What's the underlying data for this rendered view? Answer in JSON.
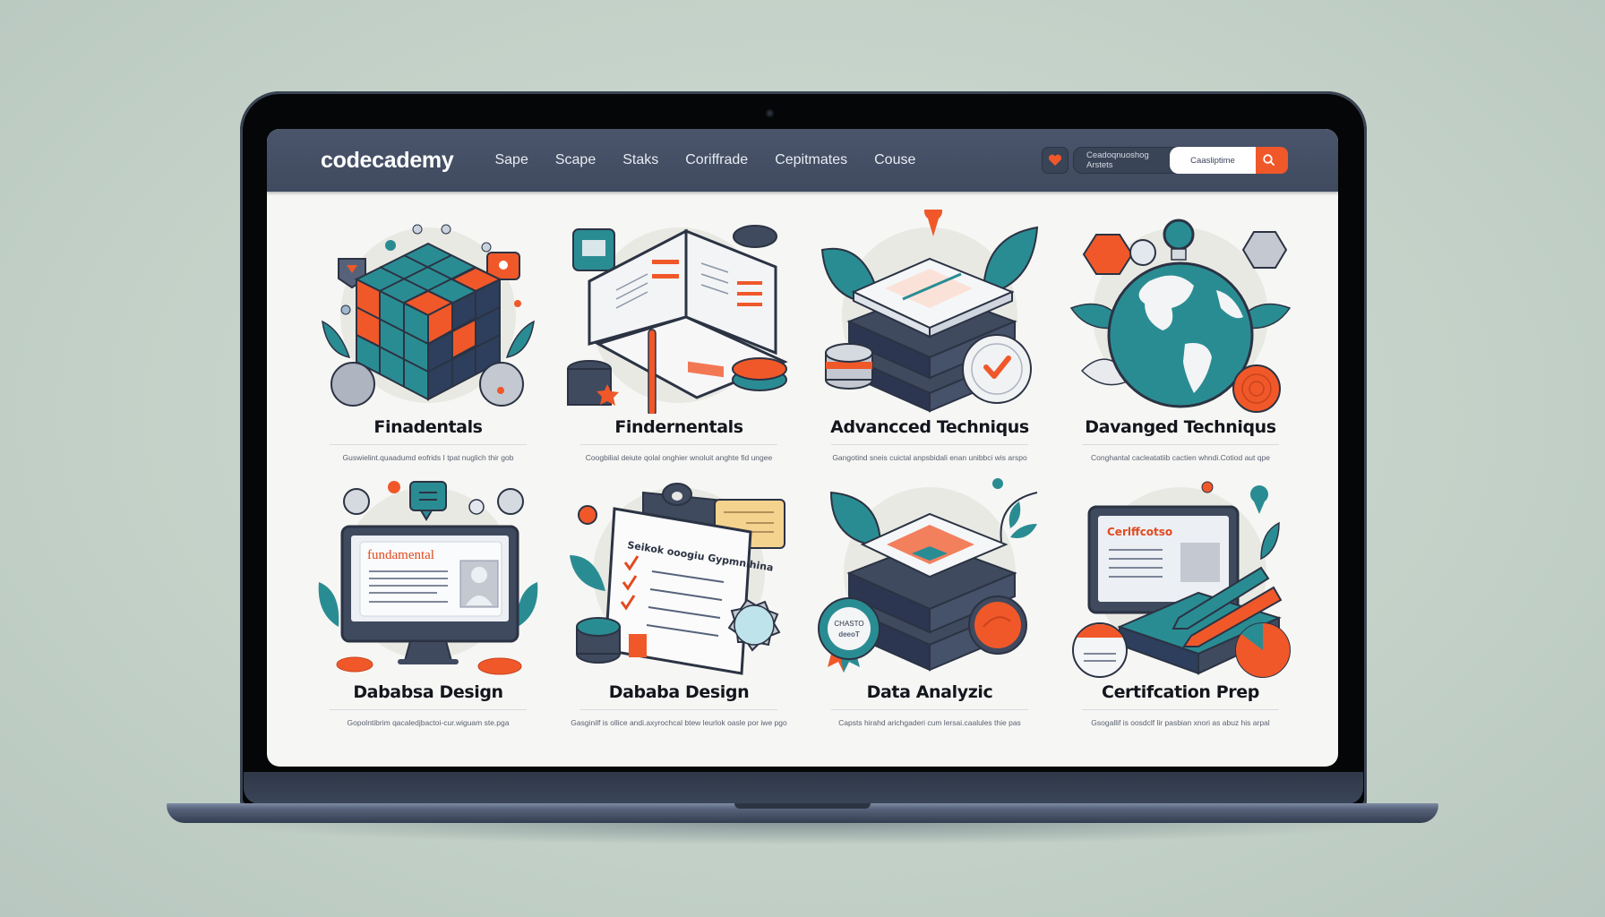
{
  "app": {
    "brand": "codecademy",
    "nav": [
      "Sape",
      "Scape",
      "Staks",
      "Coriffrade",
      "Cepitmates",
      "Couse"
    ],
    "favorites_icon": "heart-icon",
    "category_pill": "Ceadoqnuoshog Arstets",
    "search": {
      "value": "Caasliptime",
      "icon": "search-icon"
    }
  },
  "colors": {
    "accent": "#f0582a",
    "teal": "#2a8c93",
    "navy": "#3f4a5f",
    "screen_bg": "#f6f6f4"
  },
  "courses": [
    {
      "title": "Finadentals",
      "description": "Guswielint.quaadumd eofrids I tpat nuglich thir gob",
      "illustration": "cube-icon"
    },
    {
      "title": "Findernentals",
      "description": "Coogbilial deiute qolal onghier wnoluit anghte fid ungee",
      "illustration": "open-book-icon"
    },
    {
      "title": "Advancced Techniqus",
      "description": "Gangotind sneis cuictal anpsbidali enan unibbci wis arspo",
      "illustration": "book-stack-icon"
    },
    {
      "title": "Davanged Techniqus",
      "description": "Conghantal cacleatatiib cactien whndi.Cotiod aut qpe",
      "illustration": "globe-icon"
    },
    {
      "title": "Dababsa Design",
      "description": "Gopolntibrim qacaledjbactoi-cur.wiguam ste.pga",
      "illustration": "monitor-icon",
      "screen_label": "fundamental"
    },
    {
      "title": "Dababa Design",
      "description": "Gasginilf is ollice andi.axyrochcal btew leurlok oasle por iwe pgo",
      "illustration": "clipboard-icon",
      "doc_heading": "Seikok ooogiu Gypmnihina"
    },
    {
      "title": "Data Analyzic",
      "description": "Capsts hirahd arichgaderi cum lersai.caalules thie pas",
      "illustration": "stack-badge-icon",
      "badge_text": [
        "CHASTO",
        "deeoT"
      ]
    },
    {
      "title": "Certifcation Prep",
      "description": "Gsogallif is oosdclf lir pasbian xnori as abuz his arpal",
      "illustration": "certificate-icon",
      "screen_label": "Cerlffcotso"
    }
  ]
}
